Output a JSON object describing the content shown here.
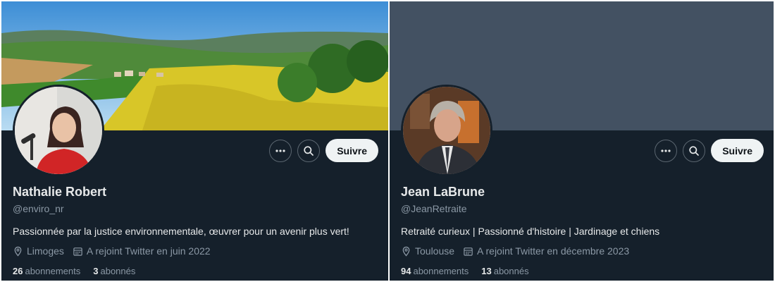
{
  "profiles": [
    {
      "name": "Nathalie Robert",
      "handle": "@enviro_nr",
      "bio": "Passionnée par la justice environnementale, œuvrer pour un avenir plus vert!",
      "location": "Limoges",
      "joined": "A rejoint Twitter en juin 2022",
      "following_count": "26",
      "following_label": "abonnements",
      "followers_count": "3",
      "followers_label": "abonnés",
      "follow_label": "Suivre",
      "banner": "countryside-landscape-photo",
      "avatar": "woman-speaking-microphone-photo"
    },
    {
      "name": "Jean LaBrune",
      "handle": "@JeanRetraite",
      "bio": "Retraité curieux  | Passionné d'histoire | Jardinage et chiens",
      "location": "Toulouse",
      "joined": "A rejoint Twitter en décembre 2023",
      "following_count": "94",
      "following_label": "abonnements",
      "followers_count": "13",
      "followers_label": "abonnés",
      "follow_label": "Suivre",
      "banner": "plain-slate-banner",
      "avatar": "elderly-man-photo"
    }
  ],
  "icons": {
    "more": "more-dots-icon",
    "search": "search-icon",
    "location": "location-pin-icon",
    "calendar": "calendar-icon"
  },
  "colors": {
    "background": "#15202b",
    "text": "#e7e9ea",
    "muted": "#8b98a5",
    "follow_button": "#eff3f4",
    "plain_banner": "#435162"
  }
}
